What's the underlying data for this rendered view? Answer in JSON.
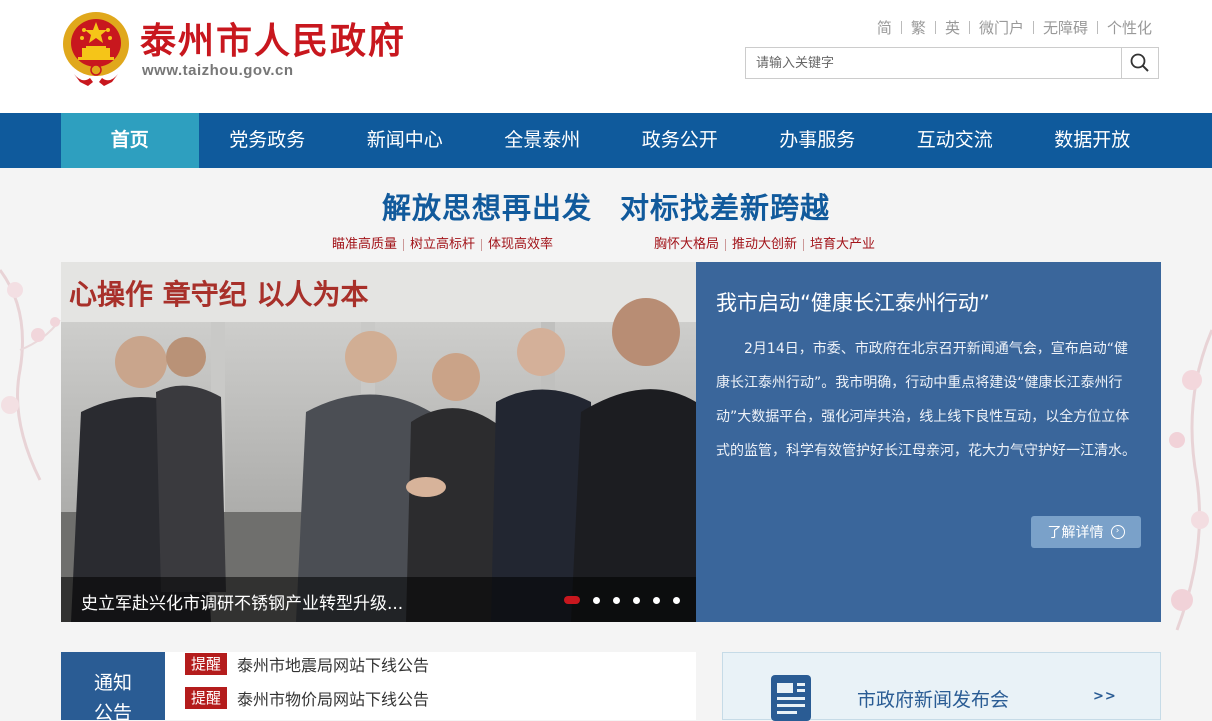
{
  "header": {
    "site_title": "泰州市人民政府",
    "site_domain": "www.taizhou.gov.cn",
    "util_links": [
      "简",
      "繁",
      "英",
      "微门户",
      "无障碍",
      "个性化"
    ],
    "search_placeholder": "请输入关键字"
  },
  "nav": {
    "items": [
      "首页",
      "党务政务",
      "新闻中心",
      "全景泰州",
      "政务公开",
      "办事服务",
      "互动交流",
      "数据开放"
    ],
    "active_index": 0
  },
  "slogan": {
    "left": "解放思想再出发",
    "right": "对标找差新跨越",
    "sub_left": [
      "瞄准高质量",
      "树立高标杆",
      "体现高效率"
    ],
    "sub_right": [
      "胸怀大格局",
      "推动大创新",
      "培育大产业"
    ]
  },
  "carousel": {
    "caption": "史立军赴兴化市调研不锈钢产业转型升级...",
    "photo_wall_text": "心操作 章守纪 以人为本",
    "slide_count": 6,
    "active_slide": 1
  },
  "feature": {
    "title": "我市启动“健康长江泰州行动”",
    "body": "2月14日，市委、市政府在北京召开新闻通气会，宣布启动“健康长江泰州行动”。我市明确，行动中重点将建设“健康长江泰州行动”大数据平台，强化河岸共治，线上线下良性互动，以全方位立体式的监管，科学有效管护好长江母亲河，花大力气守护好一江清水。",
    "more_label": "了解详情"
  },
  "notices": {
    "label_line1": "通知",
    "label_line2": "公告",
    "items": [
      {
        "tag": "提醒",
        "text": "泰州市地震局网站下线公告"
      },
      {
        "tag": "提醒",
        "text": "泰州市物价局网站下线公告"
      }
    ]
  },
  "press": {
    "title": "市政府新闻发布会",
    "more": ">>"
  },
  "colors": {
    "brand_red": "#c8171e",
    "nav_blue": "#0f5a9c",
    "nav_active": "#2e9fbf",
    "feature_blue": "#3a669b"
  }
}
